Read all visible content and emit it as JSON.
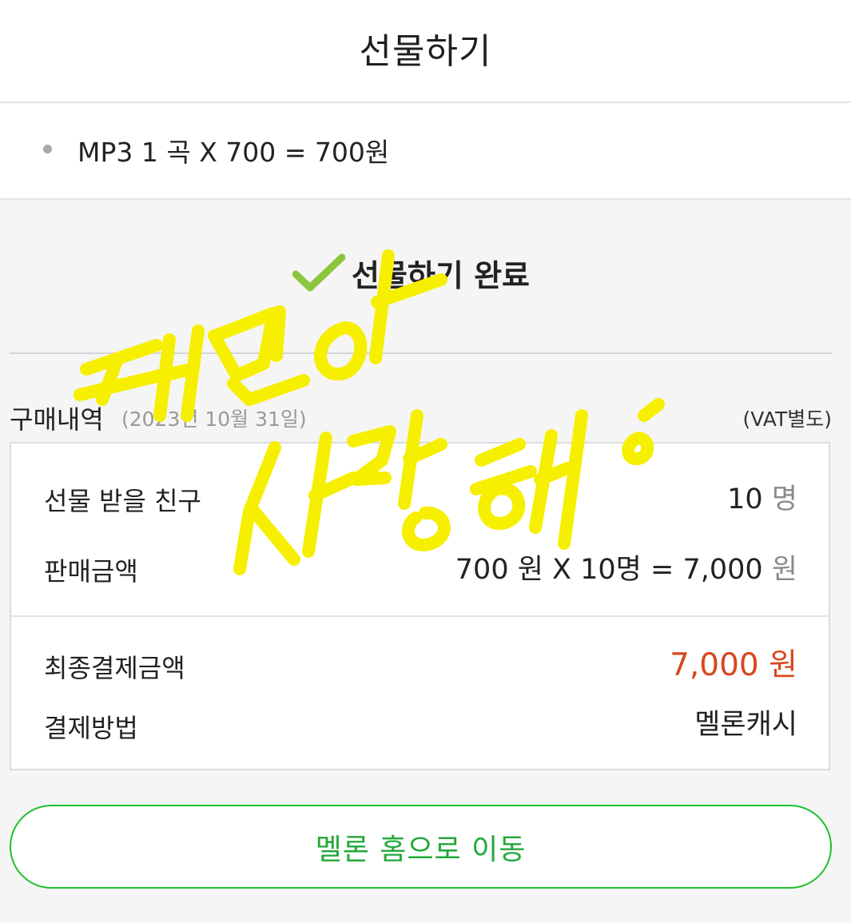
{
  "header": {
    "title": "선물하기"
  },
  "item": {
    "text": "MP3 1 곡 X 700 = 700원"
  },
  "complete": {
    "text": "선물하기 완료"
  },
  "history": {
    "label": "구매내역",
    "date": "(2023년 10월 31일)",
    "vat": "(VAT별도)"
  },
  "summary": {
    "friends_label": "선물 받을 친구",
    "friends_count": "10",
    "friends_unit": "명",
    "price_label": "판매금액",
    "price_value": "700 원 X 10명 = 7,000",
    "price_unit": "원",
    "final_label": "최종결제금액",
    "final_value": "7,000 원",
    "method_label": "결제방법",
    "method_value": "멜론캐시"
  },
  "actions": {
    "home_label": "멜론 홈으로 이동"
  },
  "overlay": {
    "handwriting_text": "태민아 사랑해"
  },
  "colors": {
    "accent_green": "#1ec12d",
    "price_red": "#d9461e",
    "handwriting_yellow": "#f6ef00"
  }
}
